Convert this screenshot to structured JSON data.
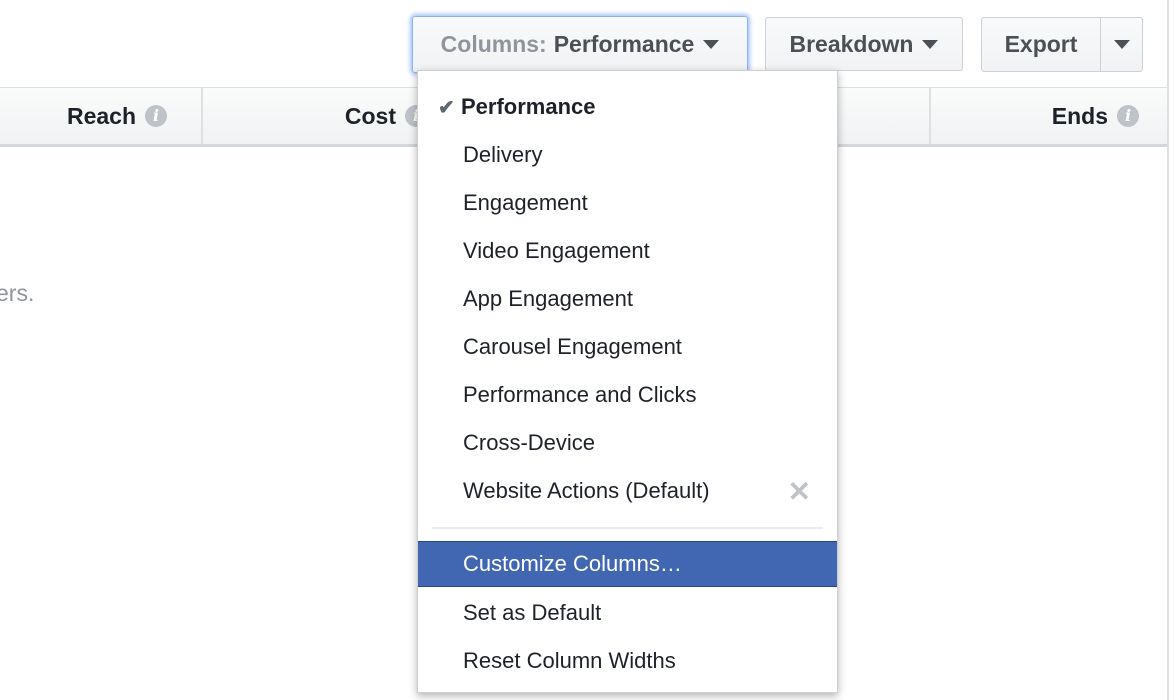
{
  "toolbar": {
    "columns_prefix": "Columns:",
    "columns_value": "Performance",
    "breakdown_label": "Breakdown",
    "export_label": "Export"
  },
  "table": {
    "headers": [
      "Reach",
      "Cost",
      "Ends"
    ],
    "empty_message_fragment": "ers."
  },
  "menu": {
    "presets": [
      {
        "label": "Performance",
        "selected": true
      },
      {
        "label": "Delivery"
      },
      {
        "label": "Engagement"
      },
      {
        "label": "Video Engagement"
      },
      {
        "label": "App Engagement"
      },
      {
        "label": "Carousel Engagement"
      },
      {
        "label": "Performance and Clicks"
      },
      {
        "label": "Cross-Device"
      },
      {
        "label": "Website Actions (Default)",
        "removable": true
      }
    ],
    "actions": [
      {
        "label": "Customize Columns…",
        "highlighted": true
      },
      {
        "label": "Set as Default"
      },
      {
        "label": "Reset Column Widths"
      }
    ]
  },
  "colors": {
    "accent": "#4267b2",
    "focus": "#a8c3f7"
  }
}
